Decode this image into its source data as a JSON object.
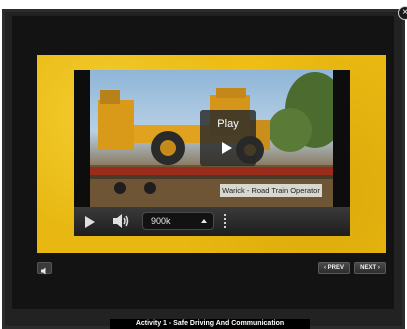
{
  "close_button": {
    "glyph": "×",
    "icon": "close-icon"
  },
  "video": {
    "play_label": "Play",
    "caption": "Warick - Road Train Operator"
  },
  "controls": {
    "quality": "900k",
    "icons": [
      "play-icon",
      "volume-icon",
      "chevron-up-icon"
    ]
  },
  "navigation": {
    "prev_label": "‹ PREV",
    "next_label": "NEXT ›"
  },
  "activity_title": "Activity 1 - Safe Driving And Communication",
  "colors": {
    "board_yellow": "#e8b711",
    "frame_dark": "#131313",
    "caption_bg": "#d8d8d0"
  }
}
